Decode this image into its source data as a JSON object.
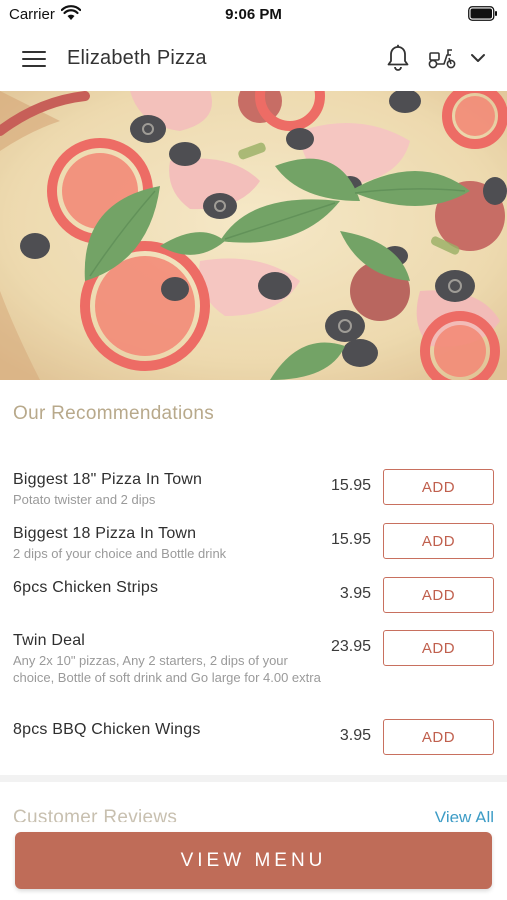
{
  "status_bar": {
    "carrier": "Carrier",
    "time": "9:06 PM"
  },
  "header": {
    "title": "Elizabeth Pizza"
  },
  "recommendations": {
    "title": "Our Recommendations",
    "items": [
      {
        "name": "Biggest 18\" Pizza In Town",
        "desc": "Potato twister and 2 dips",
        "price": "15.95",
        "button": "ADD"
      },
      {
        "name": "Biggest 18 Pizza In Town",
        "desc": "2 dips of your choice and Bottle drink",
        "price": "15.95",
        "button": "ADD"
      },
      {
        "name": "6pcs Chicken Strips",
        "desc": "",
        "price": "3.95",
        "button": "ADD"
      },
      {
        "name": "Twin Deal",
        "desc": "Any 2x 10\" pizzas, Any 2 starters, 2 dips of your choice, Bottle of soft drink and Go large for 4.00 extra",
        "price": "23.95",
        "button": "ADD"
      },
      {
        "name": "8pcs BBQ Chicken Wings",
        "desc": "",
        "price": "3.95",
        "button": "ADD"
      }
    ]
  },
  "reviews": {
    "title": "Customer Reviews",
    "view_all": "View All"
  },
  "footer": {
    "view_menu": "VIEW MENU"
  },
  "colors": {
    "accent": "#bf6c58",
    "section_title": "#b8a98b",
    "link": "#3d9cc6"
  },
  "icons": [
    "wifi-icon",
    "battery-icon",
    "menu-icon",
    "bell-icon",
    "scooter-icon",
    "chevron-down-icon"
  ]
}
